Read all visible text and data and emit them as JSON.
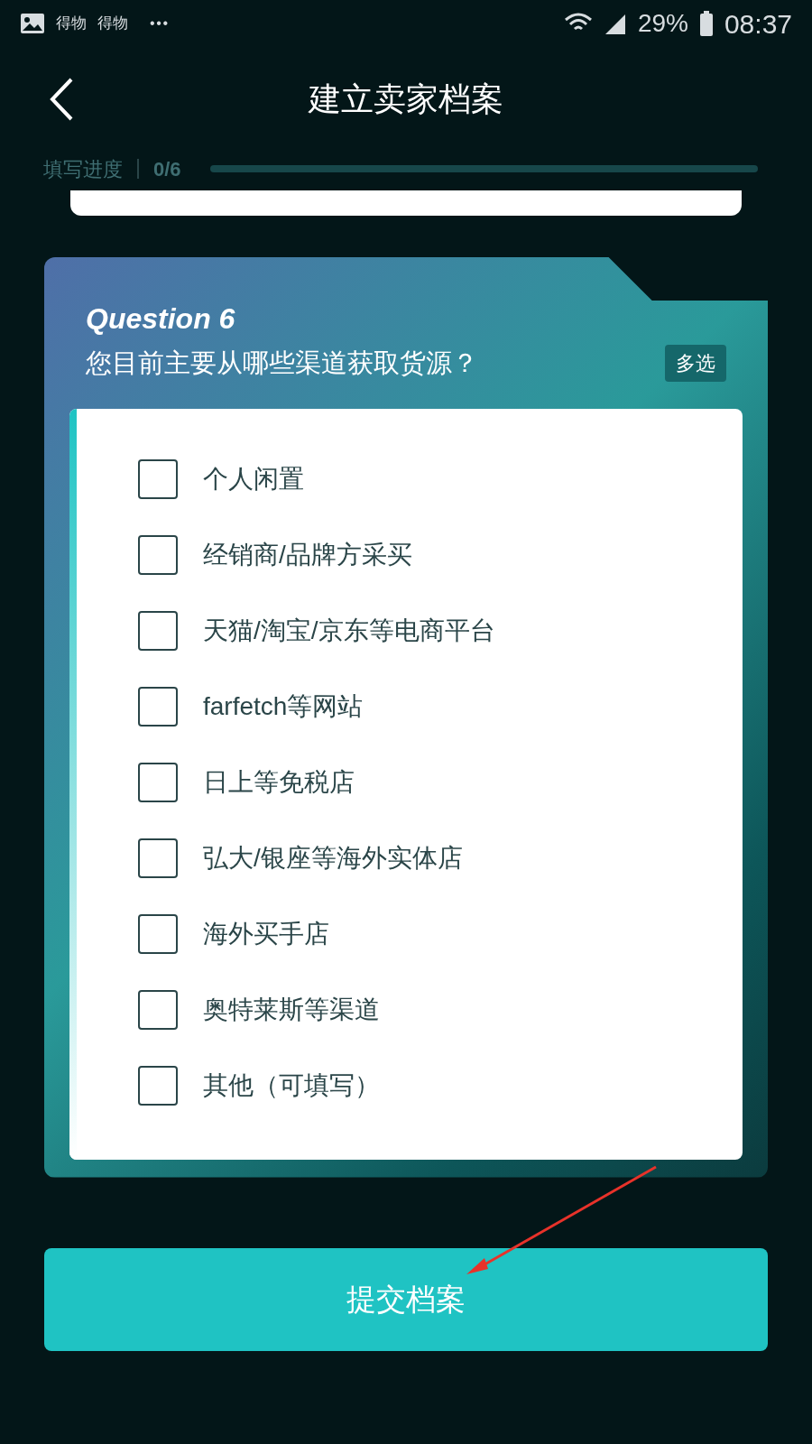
{
  "status_bar": {
    "notifications": [
      "得物",
      "得物"
    ],
    "more": "•••",
    "battery": "29%",
    "time": "08:37"
  },
  "header": {
    "title": "建立卖家档案"
  },
  "progress": {
    "label": "填写进度",
    "count": "0/6",
    "level": 0
  },
  "question": {
    "number": "Question 6",
    "text": "您目前主要从哪些渠道获取货源？",
    "badge": "多选",
    "options": [
      {
        "label": "个人闲置",
        "checked": false
      },
      {
        "label": "经销商/品牌方采买",
        "checked": false
      },
      {
        "label": "天猫/淘宝/京东等电商平台",
        "checked": false
      },
      {
        "label": "farfetch等网站",
        "checked": false
      },
      {
        "label": "日上等免税店",
        "checked": false
      },
      {
        "label": "弘大/银座等海外实体店",
        "checked": false
      },
      {
        "label": "海外买手店",
        "checked": false
      },
      {
        "label": "奥特莱斯等渠道",
        "checked": false
      },
      {
        "label": "其他（可填写）",
        "checked": false
      }
    ]
  },
  "submit": "提交档案"
}
